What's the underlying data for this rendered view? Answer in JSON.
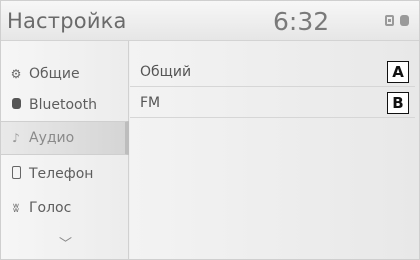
{
  "header": {
    "title": "Настройка",
    "clock": "6:32",
    "status_icons": [
      "phone-icon",
      "bluetooth-icon"
    ]
  },
  "sidebar": {
    "items": [
      {
        "label": "Общие",
        "icon": "gear-icon"
      },
      {
        "label": "Bluetooth",
        "icon": "bluetooth-icon"
      },
      {
        "label": "Аудио",
        "icon": "music-note-icon",
        "selected": true
      },
      {
        "label": "Телефон",
        "icon": "phone-icon"
      },
      {
        "label": "Голос",
        "icon": "voice-icon"
      }
    ],
    "more_icon": "chevron-down-icon"
  },
  "main": {
    "rows": [
      {
        "label": "Общий",
        "badge": "A"
      },
      {
        "label": "FM",
        "badge": "B"
      }
    ]
  }
}
